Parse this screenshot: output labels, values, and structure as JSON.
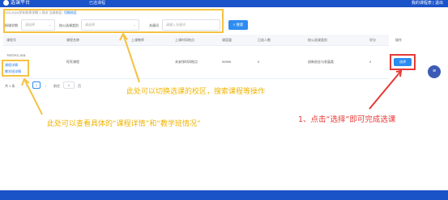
{
  "header": {
    "logo_text": "选课平台",
    "nav": "已选课程",
    "user": "我的课程表 | 退出"
  },
  "info": {
    "text": "2023-2024学年秋季学期  1 场次  当前校区:",
    "link": "切换校区"
  },
  "filters": {
    "label_1": "授课学期",
    "select_1": "请选择",
    "label_2": "校公选课类别",
    "select_2": "请选择",
    "label_3": "关键词",
    "input_placeholder": "请输入关键词",
    "search_button": "搜索"
  },
  "table": {
    "headers": [
      "课程号",
      "课程名称",
      "上课教师",
      "上课时间地点",
      "课容量",
      "已选人数",
      "校公选课类别",
      "学分",
      "操作"
    ],
    "row": {
      "course_code": "TESTKC-001",
      "course_name": "旺旺课程",
      "teacher": "",
      "time_place": "未安排时间地点",
      "capacity": "99999",
      "enrolled": "0",
      "category": "创新创业与发展类",
      "credits": "2",
      "link_detail": "课程详情",
      "link_class": "教学班详情",
      "select_button": "选择"
    }
  },
  "pagination": {
    "total": "共 1 条",
    "page": "1",
    "goto_label": "前往",
    "goto_value": "1",
    "page_unit": "页"
  },
  "annotations": {
    "switch_campus": "此处可以切换选课的校区，搜索课程等操作",
    "details": "此处可以查看具体的“课程详情”和“教学班情况”",
    "select_tip": "1、点击“选择”即可完成选课"
  },
  "colors": {
    "primary": "#1a52c8",
    "button": "#2d8cf0",
    "highlight_yellow": "#f5c242",
    "highlight_red": "#e53935"
  }
}
